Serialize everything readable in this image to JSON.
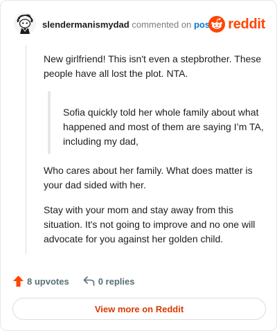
{
  "header": {
    "username": "slendermanismydad",
    "action_text": "commented on",
    "post_link": "post",
    "brand": "reddit",
    "brand_color": "#ff4500",
    "avatar_icon": "snoo-avatar-icon"
  },
  "comment": {
    "paragraph_1": "New girlfriend! This isn't even a stepbrother. These people have all lost the plot. NTA.",
    "quote": "Sofia quickly told her whole family about what happened and most of them are saying I’m TA, including my dad,",
    "paragraph_2": "Who cares about her family. What does matter is your dad sided with her.",
    "paragraph_3": "Stay with your mom and stay away from this situation. It's not going to improve and no one will advocate for you against her golden child."
  },
  "footer": {
    "upvotes": "8 upvotes",
    "replies": "0 replies",
    "upvote_icon": "upvote-arrow-icon",
    "reply_icon": "reply-arrow-icon"
  },
  "cta": {
    "label": "View more on Reddit"
  }
}
